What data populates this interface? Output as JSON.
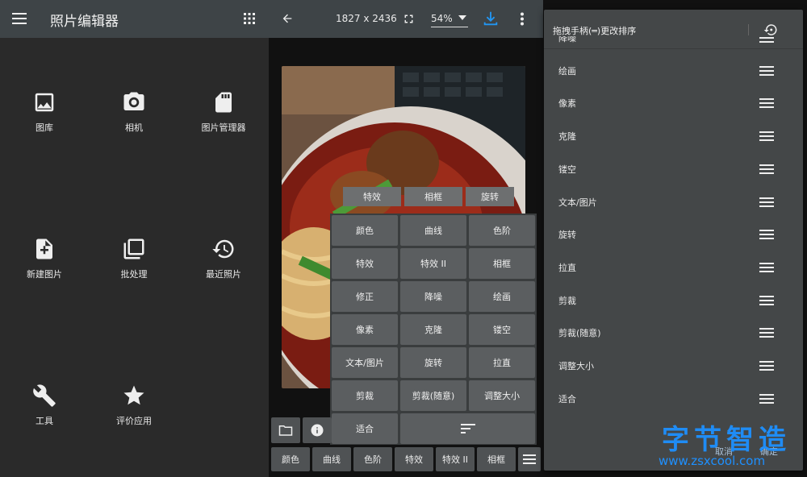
{
  "home": {
    "title": "照片编辑器",
    "tiles": [
      {
        "label": "图库",
        "icon": "image-icon"
      },
      {
        "label": "相机",
        "icon": "camera-icon"
      },
      {
        "label": "图片管理器",
        "icon": "sd-card-icon"
      },
      {
        "label": "新建图片",
        "icon": "new-file-icon"
      },
      {
        "label": "批处理",
        "icon": "batch-icon"
      },
      {
        "label": "最近照片",
        "icon": "history-icon"
      },
      {
        "label": "工具",
        "icon": "wrench-icon"
      },
      {
        "label": "评价应用",
        "icon": "star-icon"
      }
    ]
  },
  "editor": {
    "dimensions": "1827 x 2436",
    "zoom": "54%",
    "ghost_row": [
      "特效",
      "相框",
      "旋转"
    ],
    "menu": [
      [
        "颜色",
        "曲线",
        "色阶"
      ],
      [
        "特效",
        "特效 II",
        "相框"
      ],
      [
        "修正",
        "降噪",
        "绘画"
      ],
      [
        "像素",
        "克隆",
        "镂空"
      ],
      [
        "文本/图片",
        "旋转",
        "拉直"
      ],
      [
        "剪裁",
        "剪裁(随意)",
        "调整大小"
      ],
      [
        "适合"
      ]
    ],
    "bottom_bar": [
      "颜色",
      "曲线",
      "色阶",
      "特效",
      "特效 II",
      "相框"
    ]
  },
  "reorder": {
    "header": "拖拽手柄(═)更改排序",
    "items": [
      "降噪",
      "绘画",
      "像素",
      "克隆",
      "镂空",
      "文本/图片",
      "旋转",
      "拉直",
      "剪裁",
      "剪裁(随意)",
      "调整大小",
      "适合"
    ],
    "cancel": "取消",
    "confirm": "确定"
  },
  "watermark": {
    "text": "字节智造",
    "url": "www.zsxcool.com"
  },
  "colors": {
    "appbar": "#3e4447",
    "download_accent": "#2196f3",
    "watermark": "#1e90ff"
  }
}
